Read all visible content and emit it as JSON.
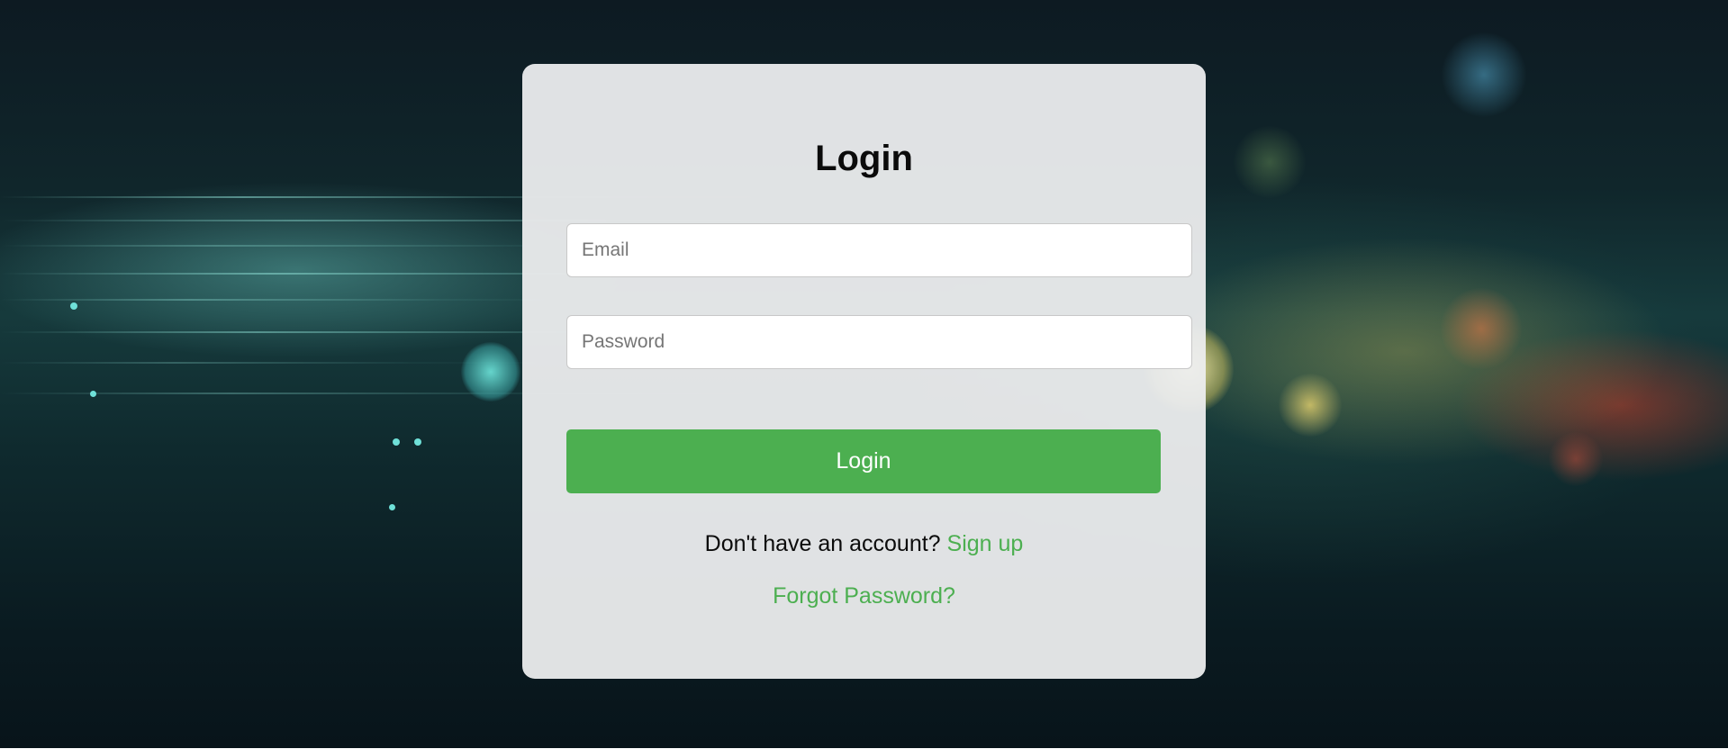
{
  "login_card": {
    "title": "Login",
    "email_placeholder": "Email",
    "email_value": "",
    "password_placeholder": "Password",
    "password_value": "",
    "submit_label": "Login",
    "signup_prompt": "Don't have an account?",
    "signup_link": "Sign up",
    "forgot_password_link": "Forgot Password?"
  },
  "colors": {
    "accent": "#4caf50",
    "card_background": "#eceded",
    "title_text": "#0b0b0b"
  }
}
